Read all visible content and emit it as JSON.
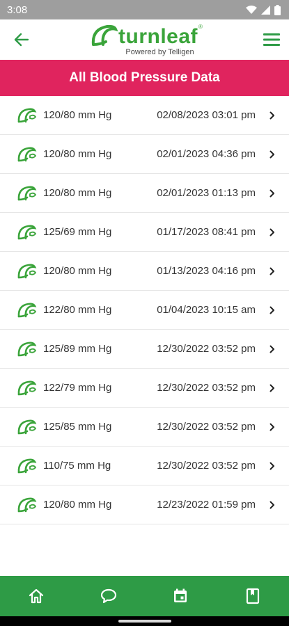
{
  "status_bar": {
    "time": "3:08",
    "icons": [
      "wifi-icon",
      "signal-icon",
      "battery-icon"
    ]
  },
  "header": {
    "back_icon": "arrow-left-icon",
    "logo_text": "turnleaf",
    "logo_tagline": "Powered by Telligen",
    "menu_icon": "hamburger-menu-icon"
  },
  "page_title": "All Blood Pressure Data",
  "colors": {
    "accent_green": "#3aa43a",
    "banner_pink": "#e0245e",
    "nav_green": "#2e9b46"
  },
  "records": [
    {
      "value": "120/80 mm Hg",
      "datetime": "02/08/2023 03:01 pm"
    },
    {
      "value": "120/80 mm Hg",
      "datetime": "02/01/2023 04:36 pm"
    },
    {
      "value": "120/80 mm Hg",
      "datetime": "02/01/2023 01:13 pm"
    },
    {
      "value": "125/69 mm Hg",
      "datetime": "01/17/2023 08:41 pm"
    },
    {
      "value": "120/80 mm Hg",
      "datetime": "01/13/2023 04:16 pm"
    },
    {
      "value": "122/80 mm Hg",
      "datetime": "01/04/2023 10:15 am"
    },
    {
      "value": "125/89 mm Hg",
      "datetime": "12/30/2022 03:52 pm"
    },
    {
      "value": "122/79 mm Hg",
      "datetime": "12/30/2022 03:52 pm"
    },
    {
      "value": "125/85 mm Hg",
      "datetime": "12/30/2022 03:52 pm"
    },
    {
      "value": "110/75 mm Hg",
      "datetime": "12/30/2022 03:52 pm"
    },
    {
      "value": "120/80 mm Hg",
      "datetime": "12/23/2022 01:59 pm"
    }
  ],
  "bottom_nav": [
    {
      "icon": "home-icon"
    },
    {
      "icon": "chat-icon"
    },
    {
      "icon": "calendar-icon"
    },
    {
      "icon": "book-icon"
    }
  ]
}
